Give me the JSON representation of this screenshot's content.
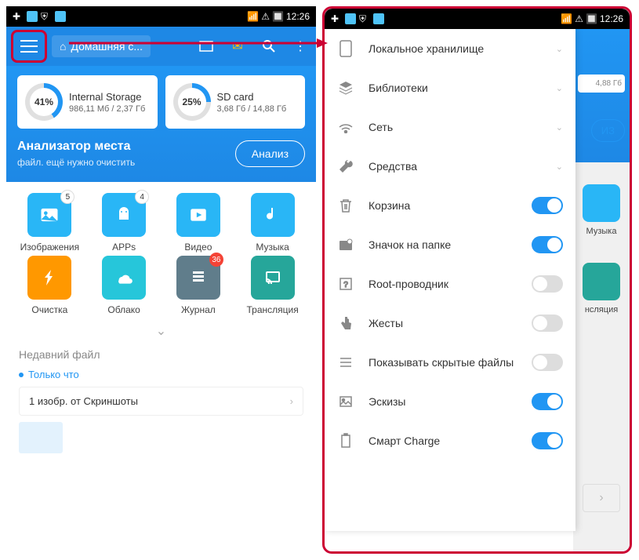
{
  "statusbar": {
    "time": "12:26"
  },
  "topbar": {
    "breadcrumb": "Домашняя с..."
  },
  "storage": {
    "card1": {
      "pct": "41%",
      "name": "Internal Storage",
      "detail": "986,11 Мб / 2,37 Гб"
    },
    "card2": {
      "pct": "25%",
      "name": "SD card",
      "detail": "3,68 Гб / 14,88 Гб"
    }
  },
  "analyzer": {
    "title": "Анализатор места",
    "sub": "файл. ещё нужно очистить",
    "btn": "Анализ"
  },
  "categories": [
    {
      "label": "Изображения",
      "badge": "5"
    },
    {
      "label": "APPs",
      "badge": "4"
    },
    {
      "label": "Видео"
    },
    {
      "label": "Музыка"
    },
    {
      "label": "Очистка"
    },
    {
      "label": "Облако"
    },
    {
      "label": "Журнал",
      "badge": "36",
      "badgeRed": true
    },
    {
      "label": "Трансляция"
    }
  ],
  "recent": {
    "title": "Недавний файл",
    "time": "Только что",
    "item": "1 изобр. от Скриншоты"
  },
  "drawer": [
    {
      "icon": "phone",
      "label": "Локальное хранилище",
      "type": "expand"
    },
    {
      "icon": "layers",
      "label": "Библиотеки",
      "type": "expand"
    },
    {
      "icon": "wifi",
      "label": "Сеть",
      "type": "expand"
    },
    {
      "icon": "wrench",
      "label": "Средства",
      "type": "expand"
    },
    {
      "icon": "trash",
      "label": "Корзина",
      "type": "toggle",
      "on": true
    },
    {
      "icon": "folder-badge",
      "label": "Значок на папке",
      "type": "toggle",
      "on": true
    },
    {
      "icon": "root",
      "label": "Root-проводник",
      "type": "toggle",
      "on": false
    },
    {
      "icon": "gesture",
      "label": "Жесты",
      "type": "toggle",
      "on": false
    },
    {
      "icon": "list",
      "label": "Показывать скрытые файлы",
      "type": "toggle",
      "on": false
    },
    {
      "icon": "image",
      "label": "Эскизы",
      "type": "toggle",
      "on": true
    },
    {
      "icon": "battery",
      "label": "Смарт Charge",
      "type": "toggle",
      "on": true
    }
  ],
  "phone2bg": {
    "storage": "4,88 Гб",
    "btn": "ИЗ",
    "label1": "Музыка",
    "label2": "нсляция"
  }
}
